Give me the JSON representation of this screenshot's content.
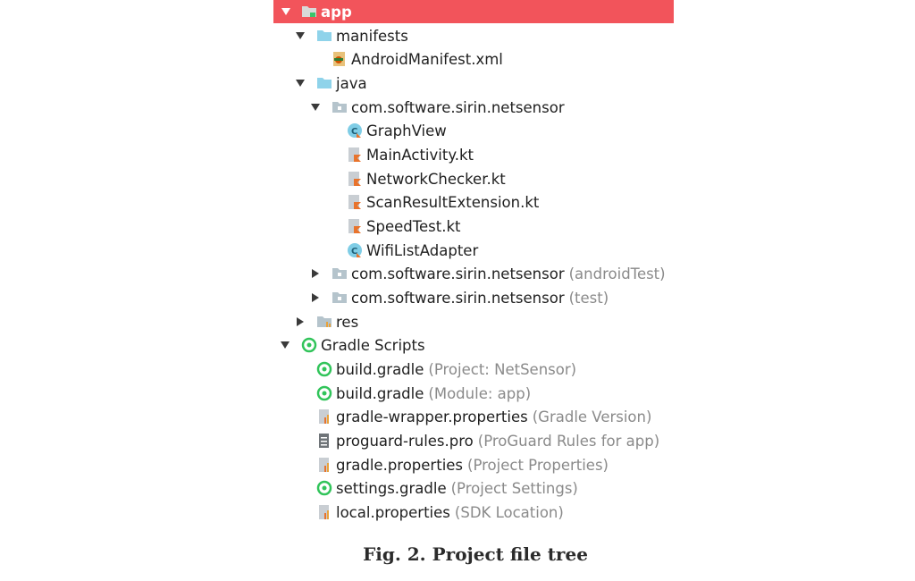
{
  "tree": {
    "app": "app",
    "manifests": "manifests",
    "android_manifest": "AndroidManifest.xml",
    "java": "java",
    "package_main": "com.software.sirin.netsensor",
    "graph_view": "GraphView",
    "main_activity": "MainActivity.kt",
    "network_checker": "NetworkChecker.kt",
    "scan_result_extension": "ScanResultExtension.kt",
    "speed_test": "SpeedTest.kt",
    "wifi_list_adapter": "WifiListAdapter",
    "package_android_test": "com.software.sirin.netsensor",
    "package_android_test_suffix": "(androidTest)",
    "package_test": "com.software.sirin.netsensor",
    "package_test_suffix": "(test)",
    "res": "res",
    "gradle_scripts": "Gradle Scripts",
    "build_gradle_project": "build.gradle",
    "build_gradle_project_suffix": "(Project: NetSensor)",
    "build_gradle_module": "build.gradle",
    "build_gradle_module_suffix": "(Module: app)",
    "gradle_wrapper_properties": "gradle-wrapper.properties",
    "gradle_wrapper_properties_suffix": "(Gradle Version)",
    "proguard_rules": "proguard-rules.pro",
    "proguard_rules_suffix": "(ProGuard Rules for app)",
    "gradle_properties": "gradle.properties",
    "gradle_properties_suffix": "(Project Properties)",
    "settings_gradle": "settings.gradle",
    "settings_gradle_suffix": "(Project Settings)",
    "local_properties": "local.properties",
    "local_properties_suffix": "(SDK Location)"
  },
  "caption": "Fig. 2. Project file tree",
  "icons": {
    "app": "app-module-folder-icon",
    "folder": "folder-icon",
    "package": "package-folder-icon",
    "manifest": "xml-manifest-icon",
    "kotlin_class": "kotlin-class-icon",
    "kotlin_file": "kotlin-file-icon",
    "res_folder": "resource-folder-icon",
    "gradle": "gradle-icon",
    "properties": "properties-file-icon",
    "text_file": "text-file-icon"
  },
  "colors": {
    "selection": "#f2545b",
    "folder": "#8fd3ea",
    "package": "#b5c4cc",
    "gradle": "#31c45a",
    "suffix": "#8a8a8a"
  }
}
